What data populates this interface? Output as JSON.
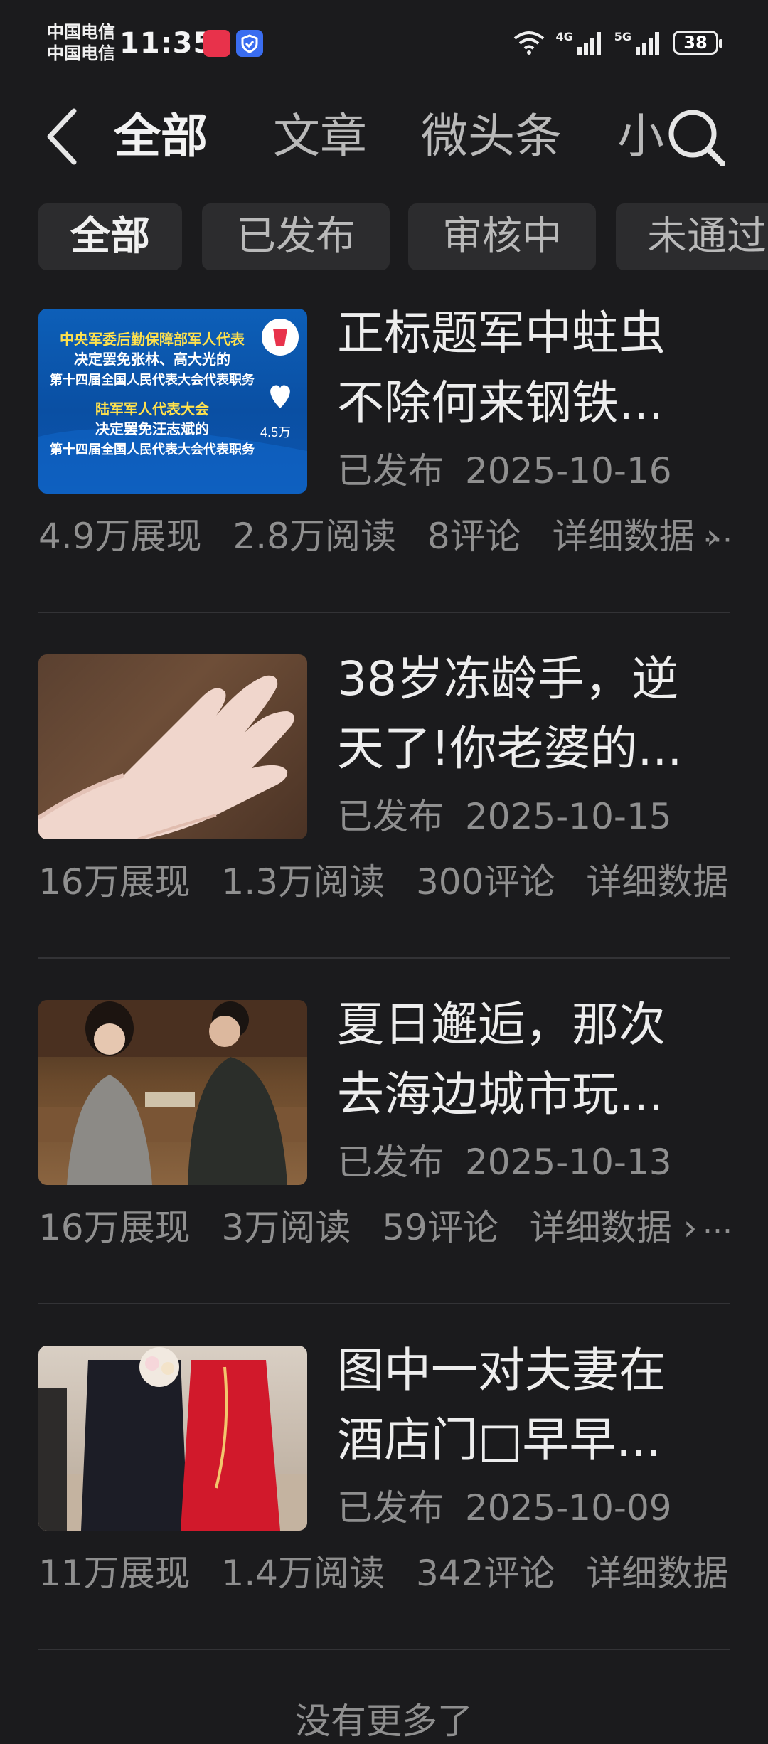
{
  "status_bar": {
    "carrier_1": "中国电信",
    "carrier_2": "中国电信",
    "time": "11:35",
    "net_1": "4G",
    "net_2": "5G",
    "battery": "38"
  },
  "header": {
    "tabs": [
      {
        "label": "全部",
        "active": true
      },
      {
        "label": "文章",
        "active": false
      },
      {
        "label": "微头条",
        "active": false
      },
      {
        "label": "小",
        "active": false
      }
    ]
  },
  "filters": [
    {
      "label": "全部",
      "active": true
    },
    {
      "label": "已发布",
      "active": false
    },
    {
      "label": "审核中",
      "active": false
    },
    {
      "label": "未通过",
      "active": false
    }
  ],
  "articles": [
    {
      "title_line1": "正标题军中蛀虫",
      "title_line2": "不除何来钢铁...",
      "status": "已发布",
      "date": "2025-10-16",
      "impressions": "4.9万展现",
      "reads": "2.8万阅读",
      "comments": "8评论",
      "details": "详细数据 ›",
      "more": "···",
      "thumb_text": [
        "中央军委后勤保障部军人代表",
        "决定罢免张林、高大光的",
        "第十四届全国人民代表大会代表职务",
        "陆军军人代表大会",
        "决定罢免汪志斌的",
        "第十四届全国人民代表大会代表职务"
      ],
      "thumb_badge": "4.5万"
    },
    {
      "title_line1": "38岁冻龄手，逆",
      "title_line2": "天了!你老婆的...",
      "status": "已发布",
      "date": "2025-10-15",
      "impressions": "16万展现",
      "reads": "1.3万阅读",
      "comments": "300评论",
      "details": "详细数据 ›",
      "more": ""
    },
    {
      "title_line1": "夏日邂逅，那次",
      "title_line2": "去海边城市玩...",
      "status": "已发布",
      "date": "2025-10-13",
      "impressions": "16万展现",
      "reads": "3万阅读",
      "comments": "59评论",
      "details": "详细数据 ›",
      "more": "···"
    },
    {
      "title_line1": "图中一对夫妻在",
      "title_line2": "酒店门□早早...",
      "status": "已发布",
      "date": "2025-10-09",
      "impressions": "11万展现",
      "reads": "1.4万阅读",
      "comments": "342评论",
      "details": "详细数据 ›",
      "more": ""
    }
  ],
  "footer": {
    "hint": "没有更多了"
  },
  "colors": {
    "background": "#1b1b1d",
    "chip": "#2c2c2e",
    "text_primary": "#ededed",
    "text_secondary": "#8f8f8f"
  }
}
